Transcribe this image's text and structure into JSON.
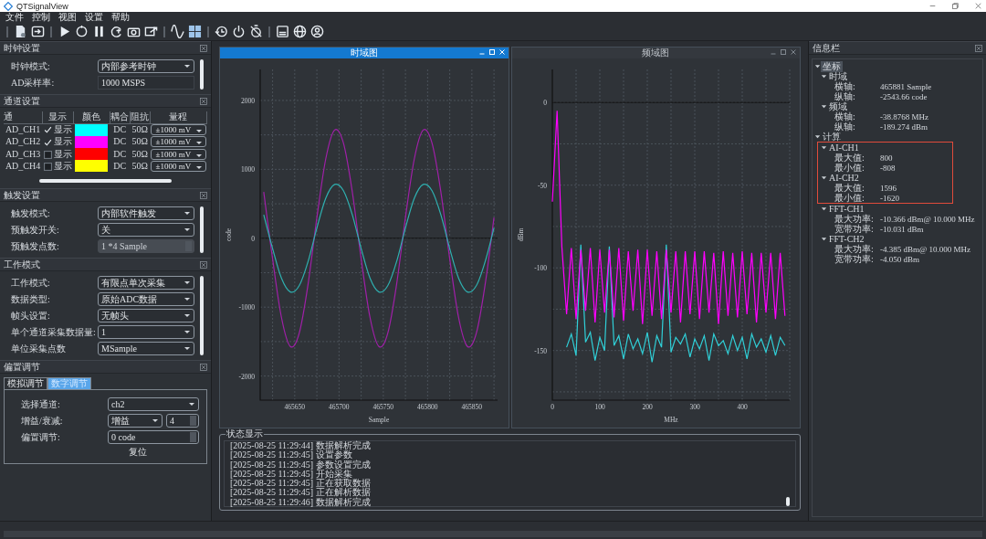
{
  "window": {
    "title": "QTSignalView"
  },
  "menu": [
    {
      "label": "文件"
    },
    {
      "label": "控制"
    },
    {
      "label": "视图"
    },
    {
      "label": "设置"
    },
    {
      "label": "帮助"
    }
  ],
  "clock_panel": {
    "title": "时钟设置",
    "fields": [
      {
        "kind": "select",
        "label": "时钟模式:",
        "value": "内部参考时钟",
        "disabled": false
      },
      {
        "kind": "text",
        "label": "AD采样率:",
        "value": "1000 MSPS",
        "disabled": false
      }
    ]
  },
  "channel_panel": {
    "title": "通道设置",
    "columns": [
      "通",
      "显示",
      "颜色",
      "耦合",
      "阻抗",
      "量程"
    ],
    "rows": [
      {
        "name": "AD_CH1",
        "checked": true,
        "show_label": "显示",
        "color": "#00ffff",
        "coupling": "DC",
        "impedance": "50Ω",
        "range": "±1000 mV"
      },
      {
        "name": "AD_CH2",
        "checked": true,
        "show_label": "显示",
        "color": "#ff00ff",
        "coupling": "DC",
        "impedance": "50Ω",
        "range": "±1000 mV"
      },
      {
        "name": "AD_CH3",
        "checked": false,
        "show_label": "显示",
        "color": "#ff0000",
        "coupling": "DC",
        "impedance": "50Ω",
        "range": "±1000 mV"
      },
      {
        "name": "AD_CH4",
        "checked": false,
        "show_label": "显示",
        "color": "#ffff00",
        "coupling": "DC",
        "impedance": "50Ω",
        "range": "±1000 mV"
      }
    ]
  },
  "trigger_panel": {
    "title": "触发设置",
    "fields": [
      {
        "kind": "select",
        "label": "触发模式:",
        "value": "内部软件触发",
        "disabled": false
      },
      {
        "kind": "select",
        "label": "预触发开关:",
        "value": "关",
        "disabled": false
      },
      {
        "kind": "spin",
        "label": "预触发点数:",
        "value": "1 *4 Sample",
        "disabled": true
      }
    ]
  },
  "work_panel": {
    "title": "工作模式",
    "fields": [
      {
        "kind": "select",
        "label": "工作模式:",
        "value": "有限点单次采集",
        "disabled": false
      },
      {
        "kind": "select",
        "label": "数据类型:",
        "value": "原始ADC数据",
        "disabled": false
      },
      {
        "kind": "select",
        "label": "帧头设置:",
        "value": "无帧头",
        "disabled": false
      },
      {
        "kind": "select",
        "label": "单个通道采集数据量:",
        "value": "1",
        "disabled": false
      },
      {
        "kind": "select",
        "label": "单位采集点数",
        "value": "MSample",
        "disabled": false
      }
    ]
  },
  "bias_panel": {
    "title": "偏置调节",
    "tabs": [
      {
        "label": "模拟调节",
        "selected": false
      },
      {
        "label": "数字调节",
        "selected": true
      }
    ],
    "fields": [
      {
        "kind": "select",
        "label": "选择通道:",
        "value": "ch2",
        "disabled": false
      },
      {
        "kind": "select_spin",
        "label": "增益/衰减:",
        "value": "增益",
        "spin_value": "4",
        "disabled": false
      },
      {
        "kind": "spin",
        "label": "偏置调节:",
        "value": "0 code",
        "disabled": false
      }
    ],
    "button": "复位"
  },
  "plot_windows": [
    {
      "title": "时域图",
      "active": true,
      "chart_data": {
        "type": "line",
        "xlabel": "Sample",
        "ylabel": "code",
        "xlim": [
          465611,
          465879
        ],
        "ylim": [
          -2350,
          2450
        ],
        "xticks": [
          465650,
          465700,
          465750,
          465800,
          465850
        ],
        "yticks": [
          -2000,
          -1000,
          0,
          1000,
          2000
        ],
        "x": [
          465615,
          465625,
          465635,
          465645,
          465655,
          465665,
          465675,
          465685,
          465695,
          465705,
          465715,
          465725,
          465735,
          465745,
          465755,
          465765,
          465775,
          465785,
          465795,
          465805,
          465815,
          465825,
          465835,
          465845,
          465855,
          465865,
          465875
        ],
        "series": [
          {
            "color": "#a020a8",
            "values": [
              670,
              -300,
              -1150,
              -1570,
              -1380,
              -670,
              300,
              1150,
              1570,
              1380,
              670,
              -300,
              -1150,
              -1570,
              -1380,
              -670,
              300,
              1150,
              1570,
              1380,
              670,
              -300,
              -1150,
              -1570,
              -1380,
              -670,
              300
            ]
          },
          {
            "color": "#2fb0b0",
            "values": [
              340,
              -150,
              -580,
              -780,
              -690,
              -340,
              150,
              580,
              780,
              690,
              340,
              -150,
              -580,
              -780,
              -690,
              -340,
              150,
              580,
              780,
              690,
              340,
              -150,
              -580,
              -780,
              -690,
              -340,
              150
            ]
          }
        ],
        "grid": true
      }
    },
    {
      "title": "频域图",
      "active": false,
      "chart_data": {
        "type": "line",
        "xlabel": "MHz",
        "ylabel": "dBm",
        "xlim": [
          0,
          500
        ],
        "ylim": [
          -180,
          20
        ],
        "xticks": [
          0,
          100,
          200,
          300,
          400
        ],
        "yticks": [
          -150,
          -100,
          -50,
          0
        ],
        "x": [
          0,
          10,
          20,
          30,
          40,
          50,
          60,
          70,
          80,
          90,
          100,
          110,
          120,
          130,
          140,
          150,
          160,
          170,
          180,
          190,
          200,
          210,
          220,
          230,
          240,
          250,
          260,
          270,
          280,
          290,
          300,
          310,
          320,
          330,
          340,
          350,
          360,
          370,
          380,
          390,
          400,
          410,
          420,
          430,
          440,
          450,
          460,
          470,
          480,
          490
        ],
        "series": [
          {
            "color": "#30d0d8",
            "values": [
              null,
              null,
              null,
              -148,
              -140,
              -153,
              -86,
              -145,
              -139,
              -156,
              -142,
              -150,
              -87,
              -147,
              -141,
              -155,
              -140,
              -149,
              -143,
              -152,
              -139,
              -157,
              -141,
              -148,
              -86,
              -151,
              -142,
              -146,
              -140,
              -154,
              -143,
              -149,
              -141,
              -156,
              -140,
              -147,
              -144,
              -152,
              -141,
              -150,
              -142,
              -155,
              -140,
              -148,
              -143,
              -151,
              -141,
              -153,
              -142,
              -147
            ]
          },
          {
            "color": "#ff00ff",
            "values": [
              -60,
              -5,
              -87,
              -128,
              -88,
              -131,
              -89,
              -126,
              -88,
              -133,
              -89,
              -127,
              -89,
              -130,
              -88,
              -132,
              -90,
              -126,
              -89,
              -134,
              -89,
              -129,
              -90,
              -131,
              -89,
              -127,
              -90,
              -133,
              -90,
              -128,
              -90,
              -131,
              -90,
              -127,
              -91,
              -134,
              -90,
              -129,
              -91,
              -130,
              -90,
              -128,
              -91,
              -133,
              -91,
              -127,
              -91,
              -131,
              -91,
              -129
            ]
          }
        ],
        "grid": true
      }
    }
  ],
  "status_log": {
    "title": "状态显示",
    "lines": [
      "[2025-08-25 11:29:44] 数据解析完成",
      "[2025-08-25 11:29:45] 设置参数",
      "[2025-08-25 11:29:45] 参数设置完成",
      "[2025-08-25 11:29:45] 开始采集",
      "[2025-08-25 11:29:45] 正在获取数据",
      "[2025-08-25 11:29:45] 正在解析数据",
      "[2025-08-25 11:29:46] 数据解析完成"
    ]
  },
  "info_panel": {
    "title": "信息栏",
    "tree": [
      {
        "label": "坐标",
        "expanded": true,
        "selected": true,
        "children": [
          {
            "label": "时域",
            "expanded": true,
            "selected": false,
            "children": [
              {
                "label": "横轴:",
                "value": "465881 Sample",
                "selected": false
              },
              {
                "label": "纵轴:",
                "value": "-2543.66 code",
                "selected": false
              }
            ]
          },
          {
            "label": "频域",
            "expanded": true,
            "selected": false,
            "children": [
              {
                "label": "横轴:",
                "value": "-38.8768 MHz",
                "selected": false
              },
              {
                "label": "纵轴:",
                "value": "-189.274 dBm",
                "selected": false
              }
            ]
          }
        ]
      },
      {
        "label": "计算",
        "expanded": true,
        "selected": false,
        "children": [
          {
            "label": "AI-CH1",
            "expanded": true,
            "selected": false,
            "highlighted": true,
            "children": [
              {
                "label": "最大值:",
                "value": "800",
                "selected": false
              },
              {
                "label": "最小值:",
                "value": "-808",
                "selected": false
              }
            ]
          },
          {
            "label": "AI-CH2",
            "expanded": true,
            "selected": false,
            "highlighted": true,
            "children": [
              {
                "label": "最大值:",
                "value": "1596",
                "selected": false
              },
              {
                "label": "最小值:",
                "value": "-1620",
                "selected": false
              }
            ]
          },
          {
            "label": "FFT-CH1",
            "expanded": true,
            "selected": false,
            "highlighted": false,
            "children": [
              {
                "label": "最大功率:",
                "value": "-10.366 dBm@ 10.000 MHz",
                "selected": false
              },
              {
                "label": "宽带功率:",
                "value": "-10.031 dBm",
                "selected": false
              }
            ]
          },
          {
            "label": "FFT-CH2",
            "expanded": true,
            "selected": false,
            "highlighted": false,
            "children": [
              {
                "label": "最大功率:",
                "value": "-4.385 dBm@ 10.000 MHz",
                "selected": false
              },
              {
                "label": "宽带功率:",
                "value": "-4.050 dBm",
                "selected": false
              }
            ]
          }
        ]
      }
    ]
  }
}
